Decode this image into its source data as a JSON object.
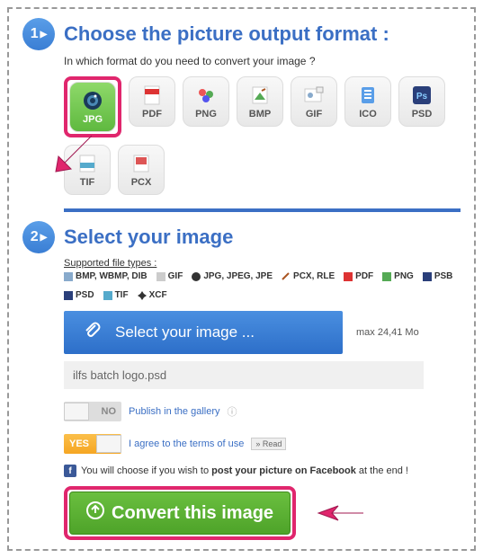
{
  "step1": {
    "number": "1",
    "title": "Choose the picture output format :",
    "subtitle": "In which format do you need to convert your image ?",
    "formats": [
      "JPG",
      "PDF",
      "PNG",
      "BMP",
      "GIF",
      "ICO",
      "PSD",
      "TIF",
      "PCX"
    ],
    "selected": "JPG"
  },
  "step2": {
    "number": "2",
    "title": "Select your image",
    "supported_label": "Supported file types :",
    "supported": [
      "BMP, WBMP, DIB",
      "GIF",
      "JPG, JPEG, JPE",
      "PCX, RLE",
      "PDF",
      "PNG",
      "PSB",
      "PSD",
      "TIF",
      "XCF"
    ],
    "select_button": "Select your image ...",
    "max_size": "max 24,41 Mo",
    "filename": "ilfs batch logo.psd",
    "publish_label": "Publish in the gallery",
    "no_label": "NO",
    "yes_label": "YES",
    "terms_label": "I agree to the terms of use",
    "read_label": "» Read",
    "fb_text_pre": "You will choose if you wish to ",
    "fb_text_bold": "post your picture on Facebook",
    "fb_text_post": " at the end !",
    "convert_label": "Convert this image"
  }
}
